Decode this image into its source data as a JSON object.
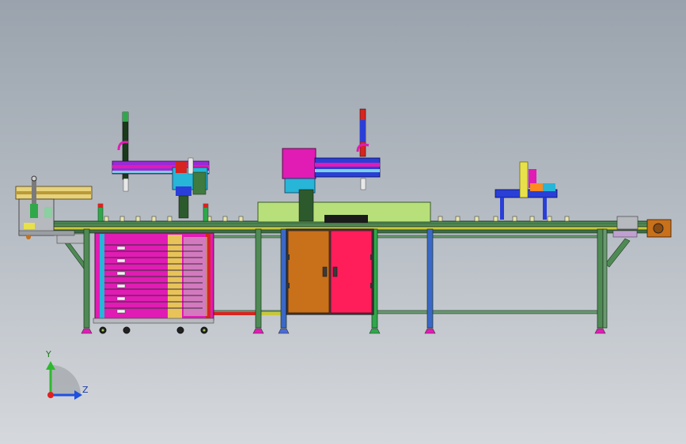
{
  "view": {
    "type": "cad-assembly-front-view",
    "background_colors": [
      "#9aa3ad",
      "#d5d8dc"
    ]
  },
  "triad": {
    "y_label": "Y",
    "z_label": "Z",
    "y_color": "#2fb82f",
    "z_color": "#2050e0",
    "origin_color": "#e02020"
  },
  "palette": {
    "frame_green": "#4f8a55",
    "frame_dark": "#2b4e30",
    "rail_yellow": "#c9c83a",
    "magenta": "#e01cb4",
    "cabinet_brown": "#c8701a",
    "cabinet_red": "#ff1e5a",
    "lime_box": "#b8e07a",
    "blue": "#2a3fd8",
    "cyan": "#27b5d8",
    "purple": "#9a2ad8",
    "red": "#d8241e"
  }
}
